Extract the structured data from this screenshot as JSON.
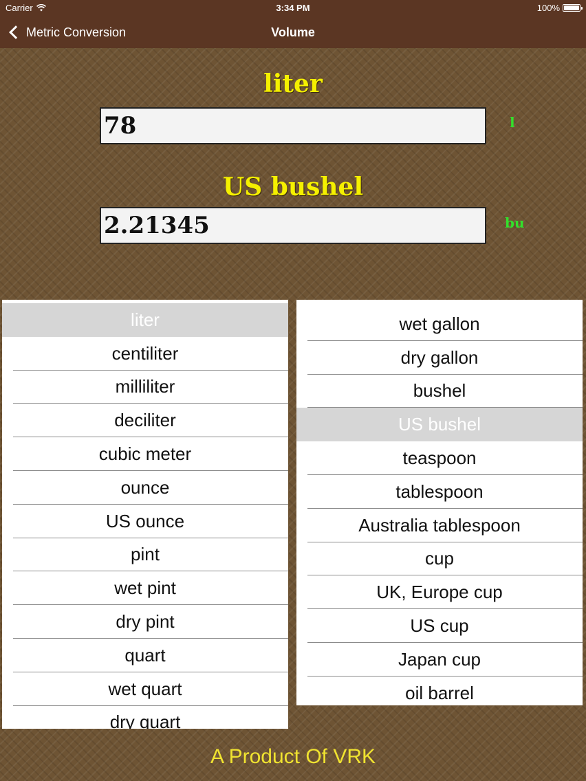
{
  "status_bar": {
    "carrier": "Carrier",
    "time": "3:34 PM",
    "battery": "100%"
  },
  "nav": {
    "back_label": "Metric Conversion",
    "title": "Volume"
  },
  "from_unit": {
    "title": "liter",
    "value": "78",
    "abbr": "l"
  },
  "to_unit": {
    "title": "US bushel",
    "value": "2.21345",
    "abbr": "bu"
  },
  "left_picker": {
    "items": [
      "liter",
      "centiliter",
      "milliliter",
      "deciliter",
      "cubic meter",
      "ounce",
      "US ounce",
      "pint",
      "wet pint",
      "dry pint",
      "quart",
      "wet quart",
      "dry quart"
    ],
    "selected": "liter"
  },
  "right_picker": {
    "items": [
      "wet gallon",
      "dry gallon",
      "bushel",
      "US bushel",
      "teaspoon",
      "tablespoon",
      "Australia tablespoon",
      "cup",
      "UK, Europe cup",
      "US cup",
      "Japan cup",
      "oil barrel"
    ],
    "selected": "US bushel"
  },
  "footer": {
    "text": "A Product Of VRK"
  },
  "colors": {
    "bar": "#5b3623",
    "title_yellow": "#f5f000",
    "abbr_green": "#33e02c",
    "footer_yellow": "#f0e330"
  }
}
